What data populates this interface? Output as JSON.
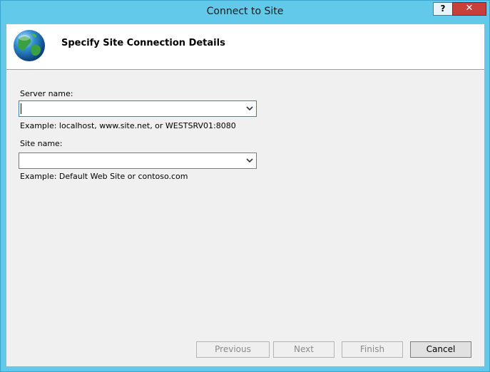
{
  "window": {
    "title": "Connect to Site",
    "help_label": "?",
    "close_label": "✕"
  },
  "header": {
    "title": "Specify Site Connection Details",
    "icon": "globe-icon"
  },
  "form": {
    "server_label": "Server name:",
    "server_value": "",
    "server_example": "Example: localhost, www.site.net, or WESTSRV01:8080",
    "site_label": "Site name:",
    "site_value": "",
    "site_example": "Example: Default Web Site or contoso.com"
  },
  "buttons": {
    "previous": "Previous",
    "next": "Next",
    "finish": "Finish",
    "cancel": "Cancel"
  },
  "colors": {
    "frame": "#62c9ea",
    "close": "#c7403a"
  }
}
